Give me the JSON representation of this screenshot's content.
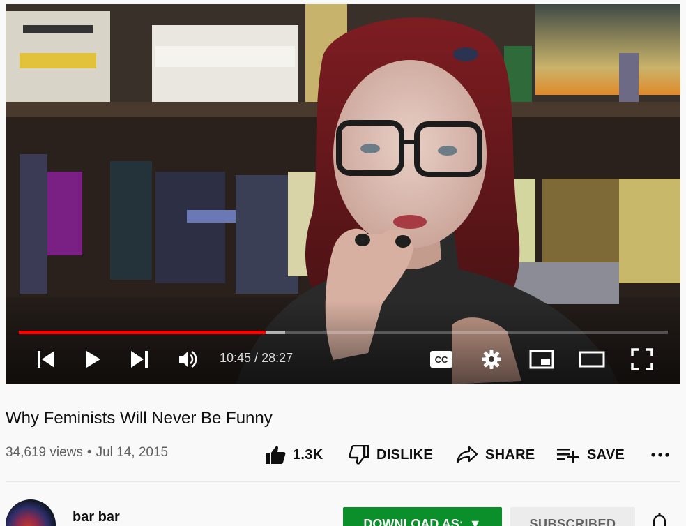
{
  "player": {
    "progress": {
      "played_fraction": 0.38,
      "buffered_fraction": 0.41
    },
    "time": {
      "current": "10:45",
      "separator": " / ",
      "duration": "28:27"
    },
    "controls": {
      "prev_icon": "skip-previous-icon",
      "play_icon": "play-icon",
      "next_icon": "skip-next-icon",
      "volume_icon": "volume-icon",
      "cc_label": "CC",
      "settings_icon": "gear-icon",
      "miniplayer_icon": "miniplayer-icon",
      "theater_icon": "theater-mode-icon",
      "fullscreen_icon": "fullscreen-icon"
    },
    "colors": {
      "progress_played": "#ff0000"
    }
  },
  "video": {
    "title": "Why Feminists Will Never Be Funny",
    "views": "34,619 views",
    "dot": "•",
    "date": "Jul 14, 2015"
  },
  "actions": {
    "like": {
      "label": "1.3K",
      "icon": "thumbs-up-icon"
    },
    "dislike": {
      "label": "DISLIKE",
      "icon": "thumbs-down-icon"
    },
    "share": {
      "label": "SHARE",
      "icon": "share-icon"
    },
    "save": {
      "label": "SAVE",
      "icon": "playlist-add-icon"
    },
    "more": {
      "label": "...",
      "icon": "more-icon"
    }
  },
  "channel": {
    "name": "bar bar",
    "download_label": "DOWNLOAD AS:",
    "download_arrow": "▼",
    "subscribed_label": "SUBSCRIBED",
    "bell_icon": "bell-icon"
  },
  "colors": {
    "download_button": "#0b8f2b",
    "subscribed_button": "#ececec"
  }
}
